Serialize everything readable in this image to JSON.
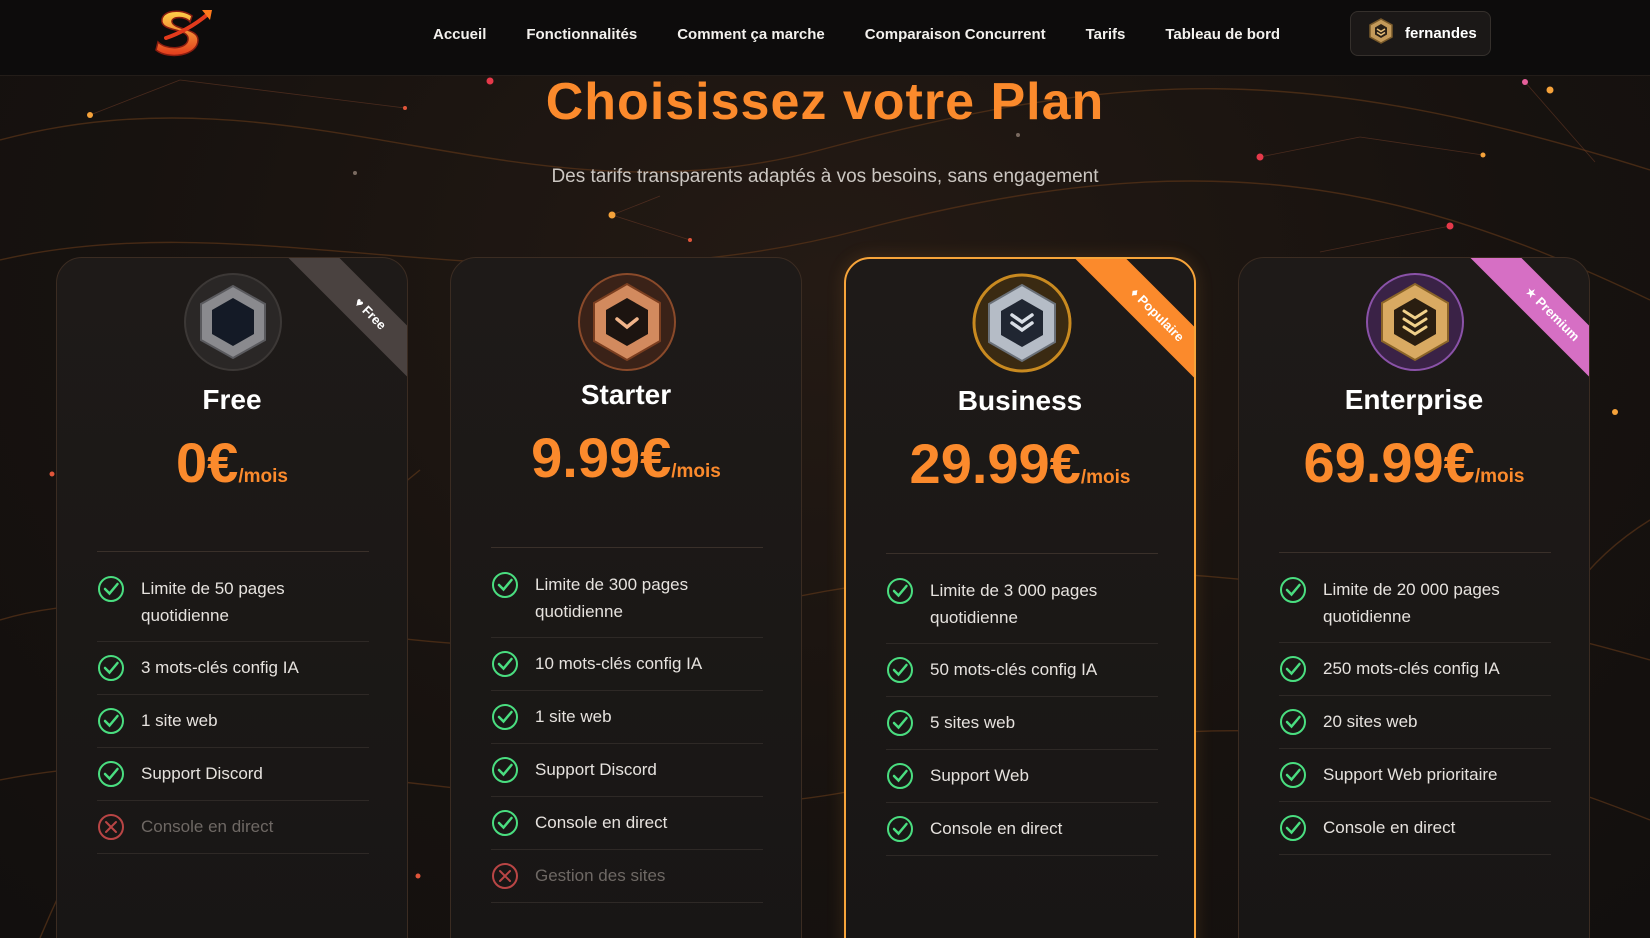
{
  "nav": {
    "links": [
      "Accueil",
      "Fonctionnalités",
      "Comment ça marche",
      "Comparaison Concurrent",
      "Tarifs",
      "Tableau de bord"
    ],
    "user": "fernandes"
  },
  "hero": {
    "title": "Choisissez votre Plan",
    "subtitle": "Des tarifs transparents adaptés à vos besoins, sans engagement"
  },
  "plans": [
    {
      "name": "Free",
      "price": "0€",
      "per": "/mois",
      "ribbon": "Free",
      "ribbon_color": "#4a4240",
      "features": [
        {
          "text": "Limite de 50 pages quotidienne",
          "ok": true
        },
        {
          "text": "3 mots-clés config IA",
          "ok": true
        },
        {
          "text": "1 site web",
          "ok": true
        },
        {
          "text": "Support Discord",
          "ok": true
        },
        {
          "text": "Console en direct",
          "ok": false
        }
      ]
    },
    {
      "name": "Starter",
      "price": "9.99€",
      "per": "/mois",
      "ribbon": "",
      "ribbon_color": "",
      "features": [
        {
          "text": "Limite de 300 pages quotidienne",
          "ok": true
        },
        {
          "text": "10 mots-clés config IA",
          "ok": true
        },
        {
          "text": "1 site web",
          "ok": true
        },
        {
          "text": "Support Discord",
          "ok": true
        },
        {
          "text": "Console en direct",
          "ok": true
        },
        {
          "text": "Gestion des sites",
          "ok": false
        }
      ]
    },
    {
      "name": "Business",
      "price": "29.99€",
      "per": "/mois",
      "ribbon": "Populaire",
      "ribbon_color": "#fb8a2c",
      "features": [
        {
          "text": "Limite de 3 000 pages quotidienne",
          "ok": true
        },
        {
          "text": "50 mots-clés config IA",
          "ok": true
        },
        {
          "text": "5 sites web",
          "ok": true
        },
        {
          "text": "Support Web",
          "ok": true
        },
        {
          "text": "Console en direct",
          "ok": true
        }
      ]
    },
    {
      "name": "Enterprise",
      "price": "69.99€",
      "per": "/mois",
      "ribbon": "Premium",
      "ribbon_color": "#d66fc4",
      "features": [
        {
          "text": "Limite de 20 000 pages quotidienne",
          "ok": true
        },
        {
          "text": "250 mots-clés config IA",
          "ok": true
        },
        {
          "text": "20 sites web",
          "ok": true
        },
        {
          "text": "Support Web prioritaire",
          "ok": true
        },
        {
          "text": "Console en direct",
          "ok": true
        }
      ]
    }
  ],
  "colors": {
    "accent": "#fb8a2c",
    "check": "#4ade80",
    "cross": "#b94545",
    "featured_border": "#f7a43a"
  }
}
